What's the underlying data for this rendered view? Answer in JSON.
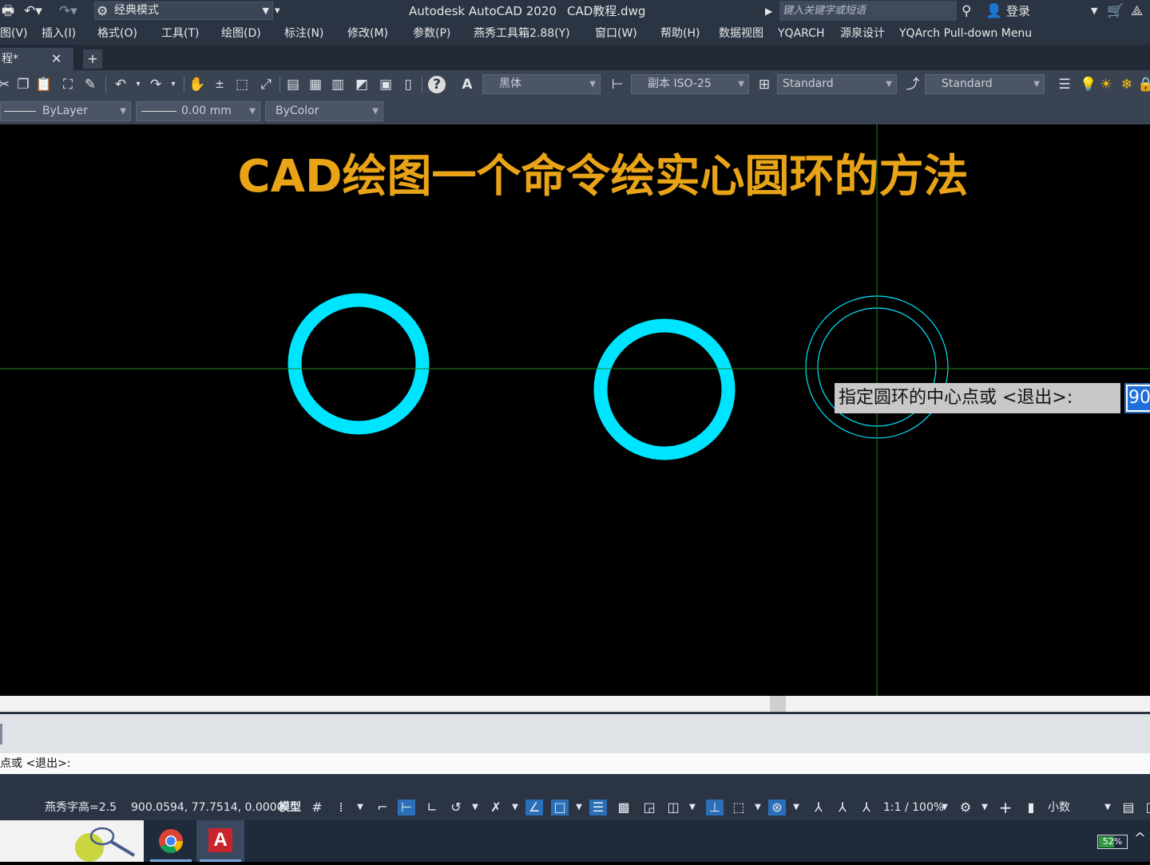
{
  "titlebar": {
    "title": "Autodesk AutoCAD 2020",
    "document": "CAD教程.dwg",
    "workspace": "经典模式",
    "search_placeholder": "键入关键字或短语",
    "signin": "登录"
  },
  "menu": [
    "图(V)",
    "插入(I)",
    "格式(O)",
    "工具(T)",
    "绘图(D)",
    "标注(N)",
    "修改(M)",
    "参数(P)",
    "燕秀工具箱2.88(Y)",
    "窗口(W)",
    "帮助(H)",
    "数据视图",
    "YQARCH",
    "源泉设计",
    "YQArch Pull-down Menu"
  ],
  "tabs": {
    "active": "程*",
    "close_icon": "close-icon",
    "add": "+"
  },
  "toolbar": {
    "text_style": "黑体",
    "dim_style": "副本 ISO-25",
    "table_style": "Standard",
    "multileader_style": "Standard",
    "help": "?"
  },
  "properties": {
    "linetype": "ByLayer",
    "lineweight": "0.00 mm",
    "color": "ByColor"
  },
  "drawing": {
    "title": "CAD绘图一个命令绘实心圆环的方法",
    "title_color": "#e8a317",
    "donut_color": "#00e5ff",
    "crosshair_color": "#1f8a1f",
    "tooltip_prompt": "指定圆环的中心点或 <退出>:",
    "tooltip_input": "90"
  },
  "command": {
    "line": "点或 <退出>:"
  },
  "status": {
    "text_height": "燕秀字高=2.5",
    "coordinates": "900.0594, 77.7514, 0.0000",
    "space": "模型",
    "scale": "1:1 / 100%",
    "units": "小数"
  },
  "taskbar": {
    "battery": "52%",
    "up_icon": "^"
  }
}
